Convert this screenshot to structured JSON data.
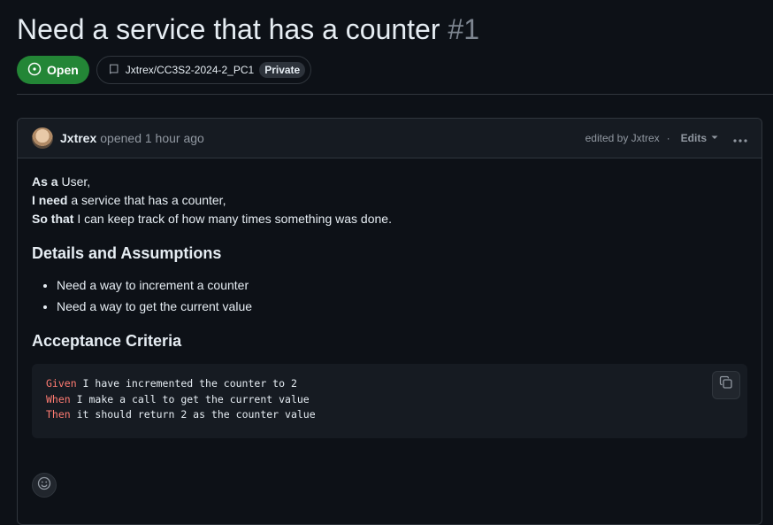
{
  "issue": {
    "title": "Need a service that has a counter",
    "number": "#1",
    "state": "Open",
    "repo": "Jxtrex/CC3S2-2024-2_PC1",
    "visibility": "Private"
  },
  "comment": {
    "author": "Jxtrex",
    "opened_text": "opened 1 hour ago",
    "edited_text": "edited by Jxtrex",
    "separator": "·",
    "edits_label": "Edits",
    "story": [
      {
        "strong": "As a",
        "rest": " User,"
      },
      {
        "strong": "I need",
        "rest": " a service that has a counter,"
      },
      {
        "strong": "So that",
        "rest": " I can keep track of how many times something was done."
      }
    ],
    "details_heading": "Details and Assumptions",
    "details_items": [
      "Need a way to increment a counter",
      "Need a way to get the current value"
    ],
    "acceptance_heading": "Acceptance Criteria",
    "code_lines": [
      {
        "kw": "Given",
        "text": " I have incremented the counter to 2"
      },
      {
        "kw": "When",
        "text": " I make a call to get the current value"
      },
      {
        "kw": "Then",
        "text": " it should return 2 as the counter value"
      }
    ]
  },
  "colors": {
    "open_badge": "#238636",
    "keyword": "#ff7b72",
    "background": "#0d1117"
  },
  "icons": [
    "issue-open-icon",
    "repo-icon",
    "caret-down-icon",
    "kebab-icon",
    "copy-icon",
    "smiley-icon"
  ]
}
